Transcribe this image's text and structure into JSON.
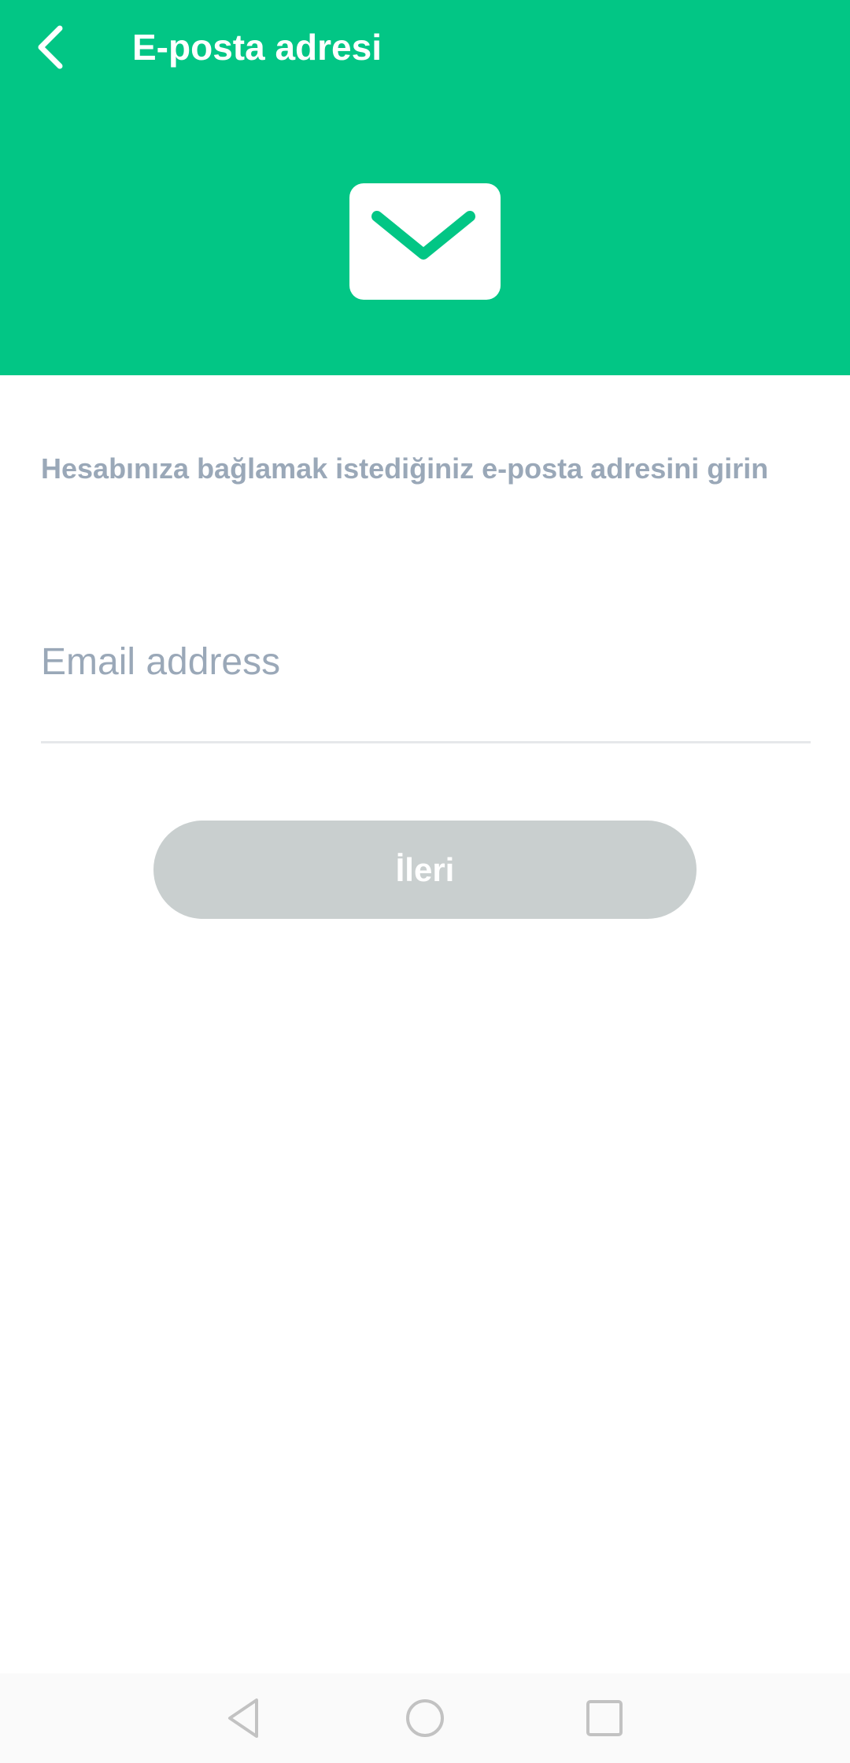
{
  "header": {
    "title": "E-posta adresi",
    "back_icon": "chevron-left-icon",
    "hero_icon": "envelope-icon",
    "color": "#02c685"
  },
  "main": {
    "subtitle": "Hesabınıza bağlamak istediğiniz e-posta adresini girin",
    "email_input": {
      "placeholder": "Email address",
      "value": ""
    },
    "next_button": {
      "label": "İleri",
      "enabled": false
    }
  },
  "navbar": {
    "icons": [
      "back-triangle-icon",
      "home-circle-icon",
      "recents-square-icon"
    ]
  }
}
